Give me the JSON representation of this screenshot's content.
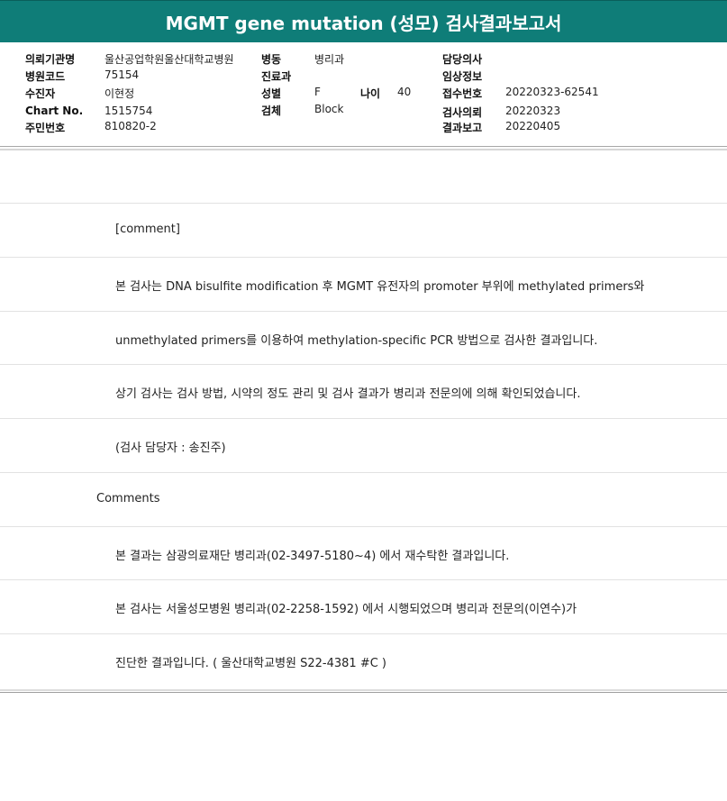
{
  "title": "MGMT gene mutation (성모) 검사결과보고서",
  "info": {
    "institution_label": "의뢰기관명",
    "institution_value": "울산공업학원울산대학교병원",
    "hospital_code_label": "병원코드",
    "hospital_code_value": "75154",
    "recipient_label": "수진자",
    "recipient_value": "이현정",
    "chart_no_label": "Chart No.",
    "chart_no_value": "1515754",
    "resident_no_label": "주민번호",
    "resident_no_value": "810820-2",
    "ward_label": "병동",
    "ward_value": "병리과",
    "department_label": "진료과",
    "department_value": "",
    "sex_label": "성별",
    "sex_value": "F",
    "age_label": "나이",
    "age_value": "40",
    "specimen_label": "검체",
    "specimen_value": "Block",
    "doctor_label": "담당의사",
    "doctor_value": "",
    "clinical_label": "임상정보",
    "clinical_value": "",
    "receipt_no_label": "접수번호",
    "receipt_no_value": "20220323-62541",
    "request_date_label": "검사의뢰",
    "request_date_value": "20220323",
    "report_date_label": "결과보고",
    "report_date_value": "20220405"
  },
  "lines": [
    "",
    "[comment]",
    "본 검사는 DNA bisulfite modification 후 MGMT 유전자의 promoter 부위에 methylated primers와",
    "unmethylated primers를 이용하여 methylation-specific PCR 방법으로 검사한 결과입니다.",
    "상기 검사는 검사 방법, 시약의 정도 관리 및 검사 결과가 병리과 전문의에 의해 확인되었습니다.",
    "(검사 담당자 : 송진주)",
    "Comments",
    "본 결과는 삼광의료재단 병리과(02-3497-5180~4) 에서 재수탁한 결과입니다.",
    "본 검사는 서울성모병원 병리과(02-2258-1592) 에서 시행되었으며 병리과 전문의(이연수)가",
    "진단한 결과입니다. ( 울산대학교병원 S22-4381 #C )"
  ]
}
